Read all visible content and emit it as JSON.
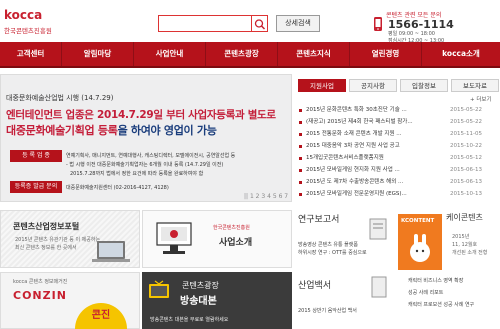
{
  "header": {
    "logo_text": "kocca",
    "logo_sub": "한국콘텐츠진흥원",
    "search_placeholder": "",
    "detail_search": "상세검색",
    "cs_title": "콘텐츠 관련 모든 문의",
    "cs_phone": "1566-1114",
    "cs_hours_1": "평일 09:00 ~ 18:00",
    "cs_hours_2": "점심시간 12:00 ~ 13:00"
  },
  "nav": [
    "고객센터",
    "알림마당",
    "사업안내",
    "콘텐츠광장",
    "콘텐츠지식",
    "열린경영",
    "kocca소개"
  ],
  "banner": {
    "top": "대중문화예술산업법 시행 (14.7.29)",
    "line1_a": "엔터테인먼트 업종",
    "line1_b": "은 2014.7.29일 부터 사업자등록과 별도로",
    "line2_a": "대중문화예술기획업 등록",
    "line2_b": "을 하여야 영업이 가능",
    "tag1": "등 록 업 종",
    "tag2": "등록증 발급 문의",
    "text1": "연예기획사, 매니지먼트, 연예대행사, 캐스팅디렉터, 모델에이전시, 공연알선업 등",
    "text2": "- 법 시행 이전 대중문화예술기획업자는 6개월 이내 등록 (14.7.29일 이전)",
    "text3": "2015.7.28까지 법에서 정한 요건에 따라 등록을 완료하여야 함",
    "contact": "대중문화예술지원센터 (02-2016-4127, 4128)",
    "pager": "|| 1 2 3 4 5 6 7"
  },
  "news": {
    "tabs": [
      "지원사업",
      "공지사항",
      "입찰정보",
      "보도자료"
    ],
    "more": "+ 더보기",
    "items": [
      {
        "title": "2015년 문화콘텐츠 특화 30초진단 기술 ...",
        "date": "2015-05-22"
      },
      {
        "title": "(재공고) 2015년 제4회 한국 패스티벌 참가...",
        "date": "2015-05-22"
      },
      {
        "title": "2015 전통문화 소재 콘텐츠 개발 지원 ...",
        "date": "2015-11-05"
      },
      {
        "title": "2015 대중음악 3차 공연 지원 사업 공고",
        "date": "2015-10-22"
      },
      {
        "title": "15개입굿콘텐츠서비스플랫폼지원",
        "date": "2015-05-12"
      },
      {
        "title": "2015년 모바일게임 현지화 지원 사업 ...",
        "date": "2015-06-13"
      },
      {
        "title": "2015년 도 제7차 수출방송콘텐츠 해외 ...",
        "date": "2015-06-13"
      },
      {
        "title": "2015년 모바일게임 전문운영지원 (EGS)...",
        "date": "2015-10-13"
      }
    ]
  },
  "bottom": {
    "portal_title": "콘텐츠산업정보포털",
    "portal_sub1": "2015년 콘텐츠 유관기관 등 이 제공하는",
    "portal_sub2": "최신 콘텐츠 정보를 한 곳에서",
    "intro_org": "한국콘텐츠진흥원",
    "intro_title": "사업소개",
    "conzin_top": "kocca 콘텐츠 정보매거진",
    "conzin_title": "CONZIN",
    "conzin_badge": "콘진",
    "plaza_title1": "콘텐츠광장",
    "plaza_title2": "방송대본",
    "plaza_sub": "방송콘텐츠 대본을 무료로 열람하세요",
    "report_title": "연구보고서",
    "report_l1": "방송영상 콘텐츠 유통 플랫폼",
    "report_l2": "하위시장 연구 : OTT를 중심으로",
    "report_more": "...",
    "white_title": "산업백서",
    "white_l1": "2015 상반기 음악산업 백서",
    "kc_title": "케이콘텐츠",
    "kc_sub1": "2015년",
    "kc_sub2": "11, 12월호",
    "kc_sub3": "개선된 소개 전형",
    "kc_cover_word": "KCONTENT",
    "list_items": [
      "캐릭터 비즈니스 영역 확장",
      "성공 사례 리포트",
      "캐릭터 프로모션 성공 사례 연구"
    ]
  }
}
